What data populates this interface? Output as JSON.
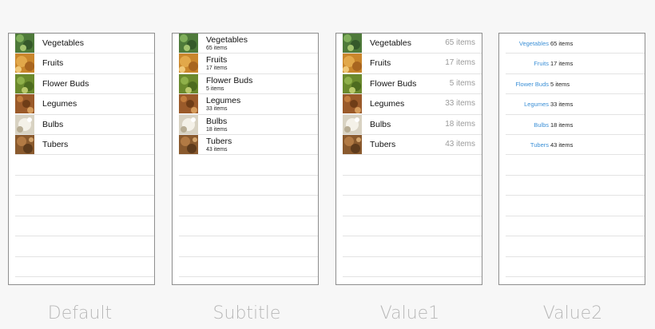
{
  "items": [
    {
      "title": "Vegetables",
      "subtitle": "65 items",
      "icon": "vegetables-photo-icon",
      "color": "#4e7a3a"
    },
    {
      "title": "Fruits",
      "subtitle": "17 items",
      "icon": "fruits-photo-icon",
      "color": "#c9862c"
    },
    {
      "title": "Flower Buds",
      "subtitle": "5 items",
      "icon": "flower-buds-photo-icon",
      "color": "#6b8a2d"
    },
    {
      "title": "Legumes",
      "subtitle": "33 items",
      "icon": "legumes-photo-icon",
      "color": "#9a5a2a"
    },
    {
      "title": "Bulbs",
      "subtitle": "18 items",
      "icon": "bulbs-photo-icon",
      "color": "#d8d2c2"
    },
    {
      "title": "Tubers",
      "subtitle": "43 items",
      "icon": "tubers-photo-icon",
      "color": "#8a5a2e"
    }
  ],
  "value1_details": [
    "65 items",
    "17 items",
    "5 items",
    "33 items",
    "18 items",
    "43 items"
  ],
  "captions": {
    "default": "Default",
    "subtitle": "Subtitle",
    "value1": "Value1",
    "value2": "Value2"
  },
  "colors": {
    "value2_accent": "#3a8fd6",
    "detail_gray": "#9a9a9a",
    "caption_gray": "#b8b8b8"
  }
}
